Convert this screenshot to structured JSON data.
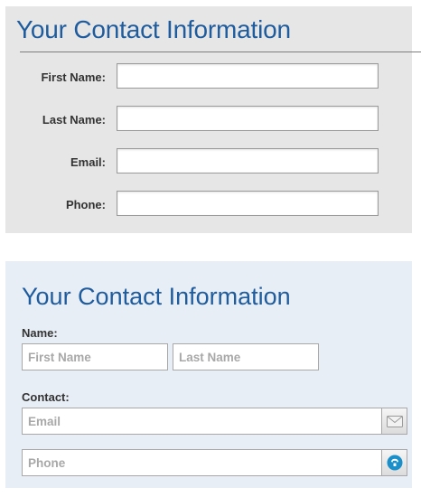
{
  "form1": {
    "title": "Your Contact Information",
    "fields": [
      {
        "label": "First Name:",
        "value": ""
      },
      {
        "label": "Last Name:",
        "value": ""
      },
      {
        "label": "Email:",
        "value": ""
      },
      {
        "label": "Phone:",
        "value": ""
      }
    ]
  },
  "form2": {
    "title": "Your Contact Information",
    "name_label": "Name:",
    "first_name_placeholder": "First Name",
    "last_name_placeholder": "Last Name",
    "contact_label": "Contact:",
    "email_placeholder": "Email",
    "phone_placeholder": "Phone",
    "email_icon": "envelope-icon",
    "phone_icon": "phone-icon"
  },
  "colors": {
    "title": "#1f5c9e",
    "form1_bg": "#e6e6e6",
    "form2_bg": "#e8eef6",
    "phone_icon": "#1a8fc9"
  }
}
